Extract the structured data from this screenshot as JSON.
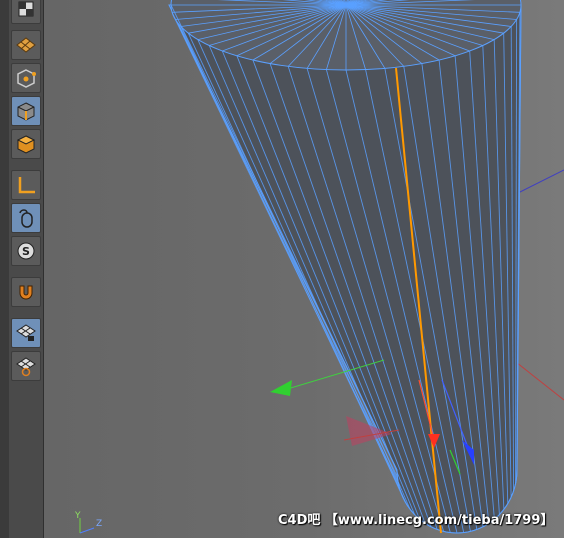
{
  "toolbar": {
    "tools": [
      {
        "icon": "checker-cube-icon",
        "active": false
      },
      {
        "icon": "texture-grid-icon",
        "active": false
      },
      {
        "icon": "point-mode-icon",
        "active": false
      },
      {
        "icon": "edge-mode-icon",
        "active": true
      },
      {
        "icon": "polygon-mode-icon",
        "active": false
      },
      {
        "icon": "axis-mode-icon",
        "active": false
      },
      {
        "icon": "tweak-mouse-icon",
        "active": false
      },
      {
        "icon": "solo-icon",
        "active": false
      },
      {
        "icon": "snap-magnet-icon",
        "active": false
      },
      {
        "icon": "workplane-lock-icon",
        "active": false
      },
      {
        "icon": "workplane-rotate-icon",
        "active": false
      }
    ]
  },
  "viewport": {
    "object_color": "#4d525a",
    "wire_color": "#5aa0ff",
    "selected_edge_color": "#ff9900"
  },
  "axis_gizmo": {
    "y_label": "Y",
    "z_label": "Z"
  },
  "watermark": "C4D吧 【www.linecg.com/tieba/1799】"
}
